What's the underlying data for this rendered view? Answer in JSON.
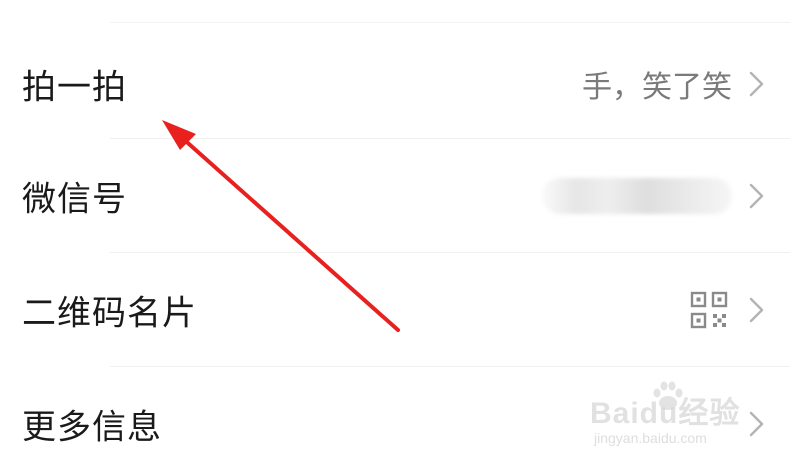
{
  "rows": [
    {
      "label": "拍一拍",
      "value": "手，笑了笑"
    },
    {
      "label": "微信号",
      "value": ""
    },
    {
      "label": "二维码名片",
      "value": ""
    },
    {
      "label": "更多信息",
      "value": ""
    }
  ],
  "watermark": {
    "main": "Baidu经验",
    "sub": "jingyan.baidu.com"
  },
  "colors": {
    "annotation_arrow": "#e8201e",
    "label_text": "#1a1a1a",
    "value_text": "#7a7a7a",
    "chevron": "#b3b3b3"
  }
}
